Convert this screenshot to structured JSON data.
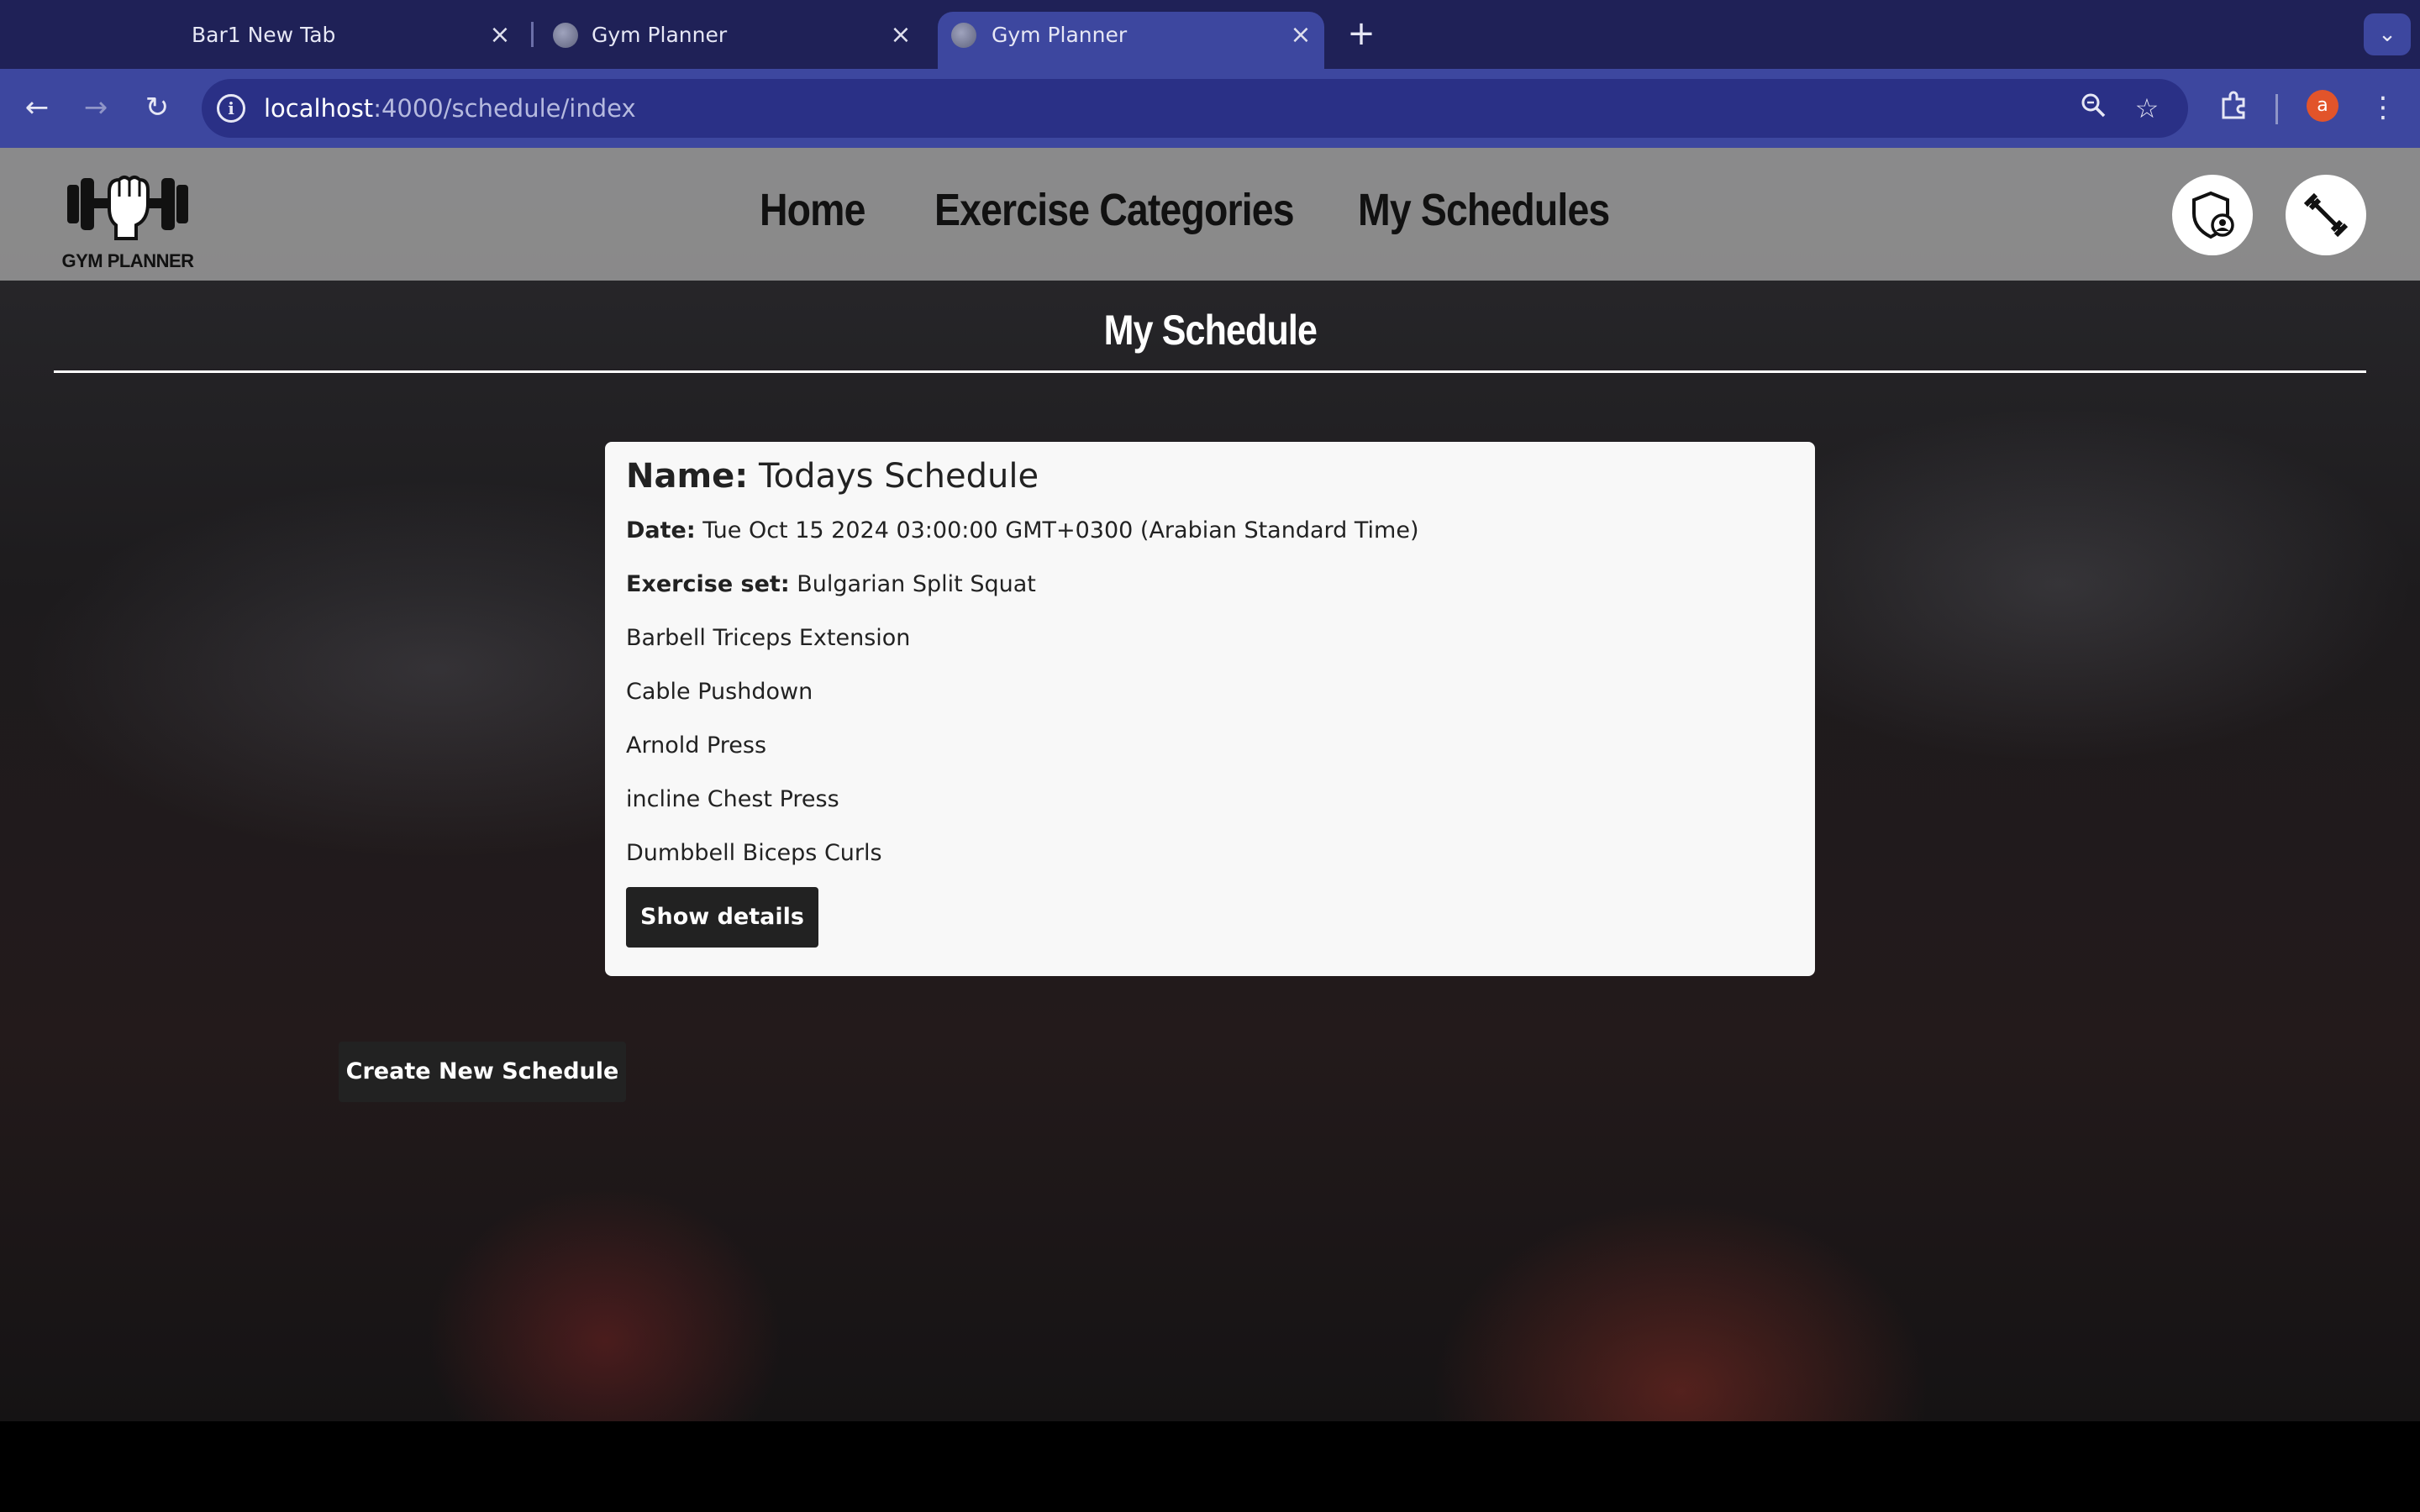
{
  "browser": {
    "tabs": [
      {
        "title": "Bar1 New Tab",
        "active": false
      },
      {
        "title": "Gym Planner",
        "active": false
      },
      {
        "title": "Gym Planner",
        "active": true
      }
    ],
    "new_tab_icon": "plus-icon",
    "tab_menu_icon": "chevron-down-icon",
    "url_host": "localhost",
    "url_path": ":4000/schedule/index",
    "profile_initial": "a",
    "colors": {
      "tabbar": "#1f2157",
      "toolbar": "#3d479f",
      "omnibox": "#2a3086",
      "profile": "#e2542a"
    }
  },
  "site": {
    "logo_text": "GYM PLANNER",
    "nav": [
      "Home",
      "Exercise Categories",
      "My Schedules"
    ],
    "admin_icon": "shield-user-icon",
    "workout_icon": "dumbbell-icon"
  },
  "page": {
    "title": "My Schedule",
    "schedule": {
      "name_label": "Name:",
      "name": "Todays Schedule",
      "date_label": "Date:",
      "date": "Tue Oct 15 2024 03:00:00 GMT+0300 (Arabian Standard Time)",
      "exercise_label": "Exercise set:",
      "exercises": [
        "Bulgarian Split Squat",
        "Barbell Triceps Extension",
        "Cable Pushdown",
        "Arnold Press",
        "incline Chest Press",
        "Dumbbell Biceps Curls"
      ],
      "details_button": "Show details"
    },
    "create_button": "Create New Schedule"
  }
}
